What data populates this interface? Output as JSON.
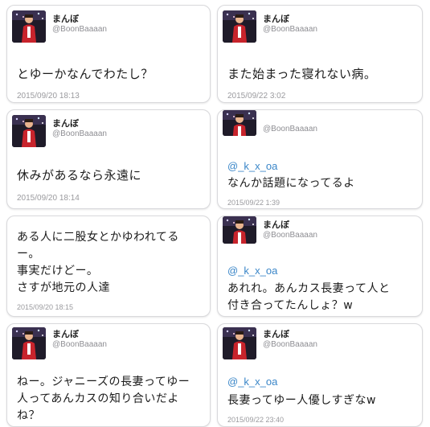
{
  "tweets": [
    {
      "name": "まんぼ",
      "handle": "@BoonBaaaan",
      "mention": "",
      "text": "とゆーかなんでわたし？",
      "time": "2015/09/20 18:13"
    },
    {
      "name": "まんぼ",
      "handle": "@BoonBaaaan",
      "mention": "",
      "text": "また始まった寝れない病。",
      "time": "2015/09/22 3:02"
    },
    {
      "name": "まんぼ",
      "handle": "@BoonBaaaan",
      "mention": "",
      "text": "休みがあるなら永遠に",
      "time": "2015/09/20 18:14"
    },
    {
      "name": "",
      "handle": "@BoonBaaaan",
      "mention": "@_k_x_oa",
      "text": "なんか話題になってるよ",
      "time": "2015/09/22 1:39"
    },
    {
      "name": "",
      "handle": "",
      "mention": "",
      "text": "ある人に二股女とかゆわれてる\nー。\n事実だけどー。\nさすが地元の人達",
      "time": "2015/09/20 18:15"
    },
    {
      "name": "まんぼ",
      "handle": "@BoonBaaaan",
      "mention": "@_k_x_oa",
      "text": "あれれ。あんカス長妻って人と\n付き合ってたんしょ？w",
      "time": ""
    },
    {
      "name": "まんぼ",
      "handle": "@BoonBaaaan",
      "mention": "",
      "text": "ねー。ジャニーズの長妻ってゆー\n人ってあんカスの知り合いだよ\nね？",
      "time": ""
    },
    {
      "name": "まんぼ",
      "handle": "@BoonBaaaan",
      "mention": "@_k_x_oa",
      "text": "長妻ってゆー人優しすぎなw",
      "time": "2015/09/22 23:40"
    }
  ]
}
